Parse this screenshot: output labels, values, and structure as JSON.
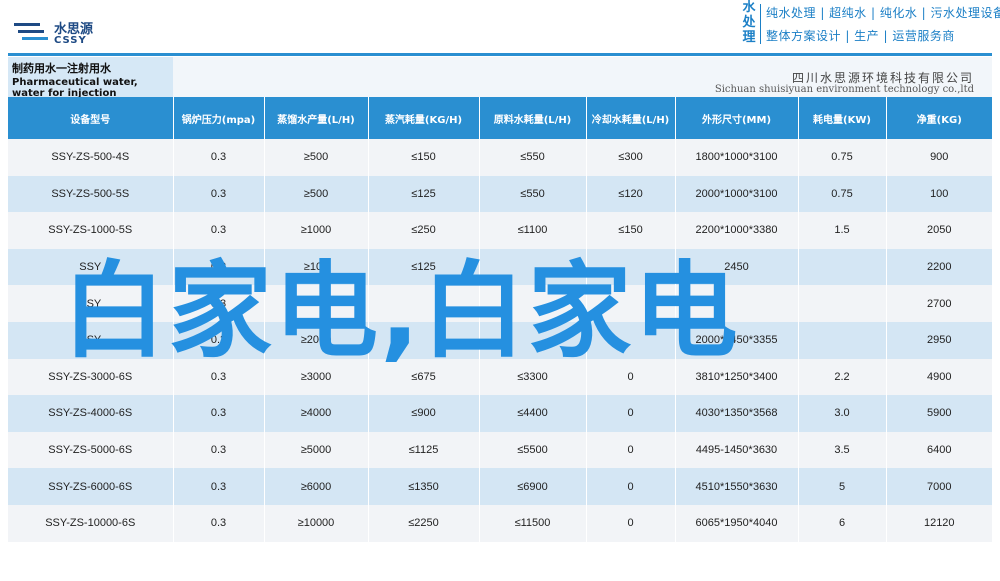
{
  "logo": {
    "name_cn": "水思源",
    "name_en": "CSSY"
  },
  "slogan": {
    "vertical": "水处理",
    "line1": "纯水处理 | 超纯水 | 纯化水 | 污水处理设备",
    "line2": "整体方案设计 | 生产 | 运营服务商"
  },
  "table_title": {
    "cn": "制药用水一注射用水",
    "en": "Pharmaceutical water, water for injection"
  },
  "company": {
    "cn": "四川水思源环境科技有限公司",
    "en": "Sichuan shuisiyuan environment technology co.,ltd"
  },
  "columns": [
    "设备型号",
    "锅炉压力(mpa)",
    "蒸馏水产量(L/H)",
    "蒸汽耗量(KG/H)",
    "原料水耗量(L/H)",
    "冷却水耗量(L/H)",
    "外形尺寸(MM)",
    "耗电量(KW)",
    "净重(KG)"
  ],
  "rows": [
    [
      "SSY-ZS-500-4S",
      "0.3",
      "≥500",
      "≤150",
      "≤550",
      "≤300",
      "1800*1000*3100",
      "0.75",
      "900"
    ],
    [
      "SSY-ZS-500-5S",
      "0.3",
      "≥500",
      "≤125",
      "≤550",
      "≤120",
      "2000*1000*3100",
      "0.75",
      "100"
    ],
    [
      "SSY-ZS-1000-5S",
      "0.3",
      "≥1000",
      "≤250",
      "≤1100",
      "≤150",
      "2200*1000*3380",
      "1.5",
      "2050"
    ],
    [
      "SSY",
      "0.3",
      "≥100",
      "≤125",
      "",
      "",
      "2450",
      "",
      "2200"
    ],
    [
      "SSY",
      "0.3",
      "",
      "",
      "",
      "",
      "",
      "",
      "2700"
    ],
    [
      "SSY",
      "0.3",
      "≥2000",
      "",
      "",
      "",
      "2000*1450*3355",
      "",
      "2950"
    ],
    [
      "SSY-ZS-3000-6S",
      "0.3",
      "≥3000",
      "≤675",
      "≤3300",
      "0",
      "3810*1250*3400",
      "2.2",
      "4900"
    ],
    [
      "SSY-ZS-4000-6S",
      "0.3",
      "≥4000",
      "≤900",
      "≤4400",
      "0",
      "4030*1350*3568",
      "3.0",
      "5900"
    ],
    [
      "SSY-ZS-5000-6S",
      "0.3",
      "≥5000",
      "≤1125",
      "≤5500",
      "0",
      "4495-1450*3630",
      "3.5",
      "6400"
    ],
    [
      "SSY-ZS-6000-6S",
      "0.3",
      "≥6000",
      "≤1350",
      "≤6900",
      "0",
      "4510*1550*3630",
      "5",
      "7000"
    ],
    [
      "SSY-ZS-10000-6S",
      "0.3",
      "≥10000",
      "≤2250",
      "≤11500",
      "0",
      "6065*1950*4040",
      "6",
      "12120"
    ]
  ],
  "overlay_text": "白家电,白家电",
  "colors": {
    "header_blue": "#2a8fd1",
    "row_light": "#f2f4f7",
    "row_blue": "#d4e6f4",
    "overlay_blue": "#2590e0"
  }
}
